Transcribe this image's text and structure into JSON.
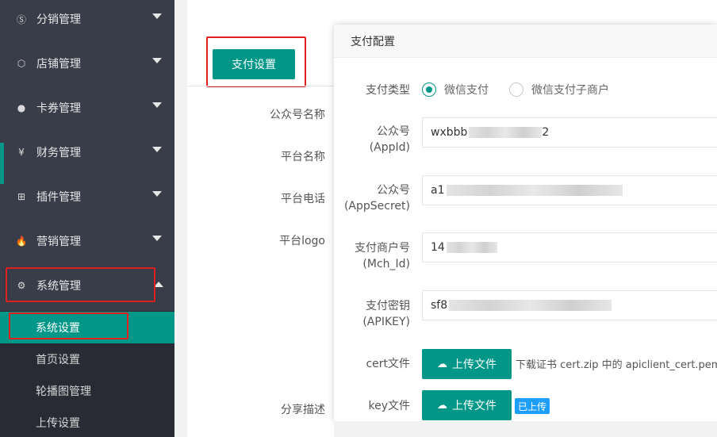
{
  "sidebar": {
    "items": [
      {
        "label": "分销管理",
        "icon": "dollar-circle-icon",
        "glyph": "Ⓢ"
      },
      {
        "label": "店铺管理",
        "icon": "cube-icon",
        "glyph": "⬡"
      },
      {
        "label": "卡券管理",
        "icon": "circle-icon",
        "glyph": "●"
      },
      {
        "label": "财务管理",
        "icon": "yen-circle-icon",
        "glyph": "¥"
      },
      {
        "label": "插件管理",
        "icon": "apps-icon",
        "glyph": "⊞"
      },
      {
        "label": "营销管理",
        "icon": "fire-icon",
        "glyph": "🔥"
      },
      {
        "label": "系统管理",
        "icon": "gear-icon",
        "glyph": "⚙"
      }
    ],
    "submenu": [
      {
        "label": "系统设置"
      },
      {
        "label": "首页设置"
      },
      {
        "label": "轮播图管理"
      },
      {
        "label": "上传设置"
      }
    ]
  },
  "main": {
    "tab_button": "支付设置",
    "labels": [
      "公众号名称",
      "平台名称",
      "平台电话",
      "平台logo",
      "分享描述"
    ]
  },
  "modal": {
    "title": "支付配置",
    "pay_type": {
      "label": "支付类型",
      "options": [
        "微信支付",
        "微信支付子商户"
      ],
      "selected": "微信支付"
    },
    "appid": {
      "label1": "公众号",
      "label2": "(AppId)",
      "value_start": "wxbbb",
      "value_end": "2"
    },
    "appsecret": {
      "label1": "公众号",
      "label2": "(AppSecret)",
      "value_start": "a1"
    },
    "mchid": {
      "label1": "支付商户号",
      "label2": "(Mch_Id)",
      "value_start": "14"
    },
    "apikey": {
      "label1": "支付密钥",
      "label2": "(APIKEY)",
      "value_start": "sf8"
    },
    "cert": {
      "label": "cert文件",
      "button": "上传文件",
      "hint": "下载证书 cert.zip 中的 apiclient_cert.pem"
    },
    "key": {
      "label": "key文件",
      "button": "上传文件",
      "badge": "已上传"
    }
  },
  "colors": {
    "accent": "#009688",
    "sidebar": "#393d49",
    "badge": "#1e9fff",
    "highlight": "#e02020"
  }
}
